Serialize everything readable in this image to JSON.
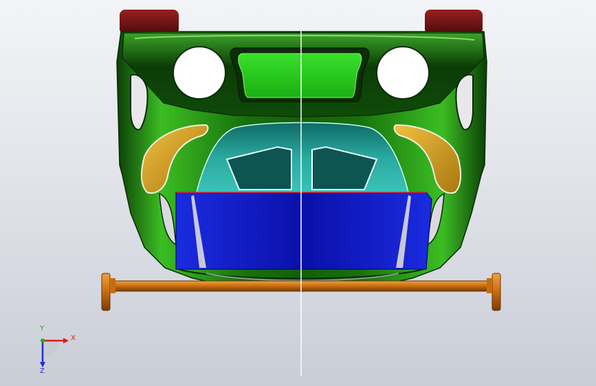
{
  "triad": {
    "x_label": "X",
    "y_label": "Y",
    "z_label": "Z",
    "colors": {
      "x": "#e01818",
      "y": "#18b018",
      "z": "#2030d0"
    }
  },
  "model": {
    "colors": {
      "body_green": "#1f8a12",
      "body_dark": "#0c3d08",
      "body_light": "#6fd94a",
      "canopy_teal": "#22a59a",
      "panel_blue": "#0a0fa8",
      "tail_lights": "#6e1010",
      "side_vents": "#d2a018",
      "axle_orange": "#c87010"
    }
  }
}
